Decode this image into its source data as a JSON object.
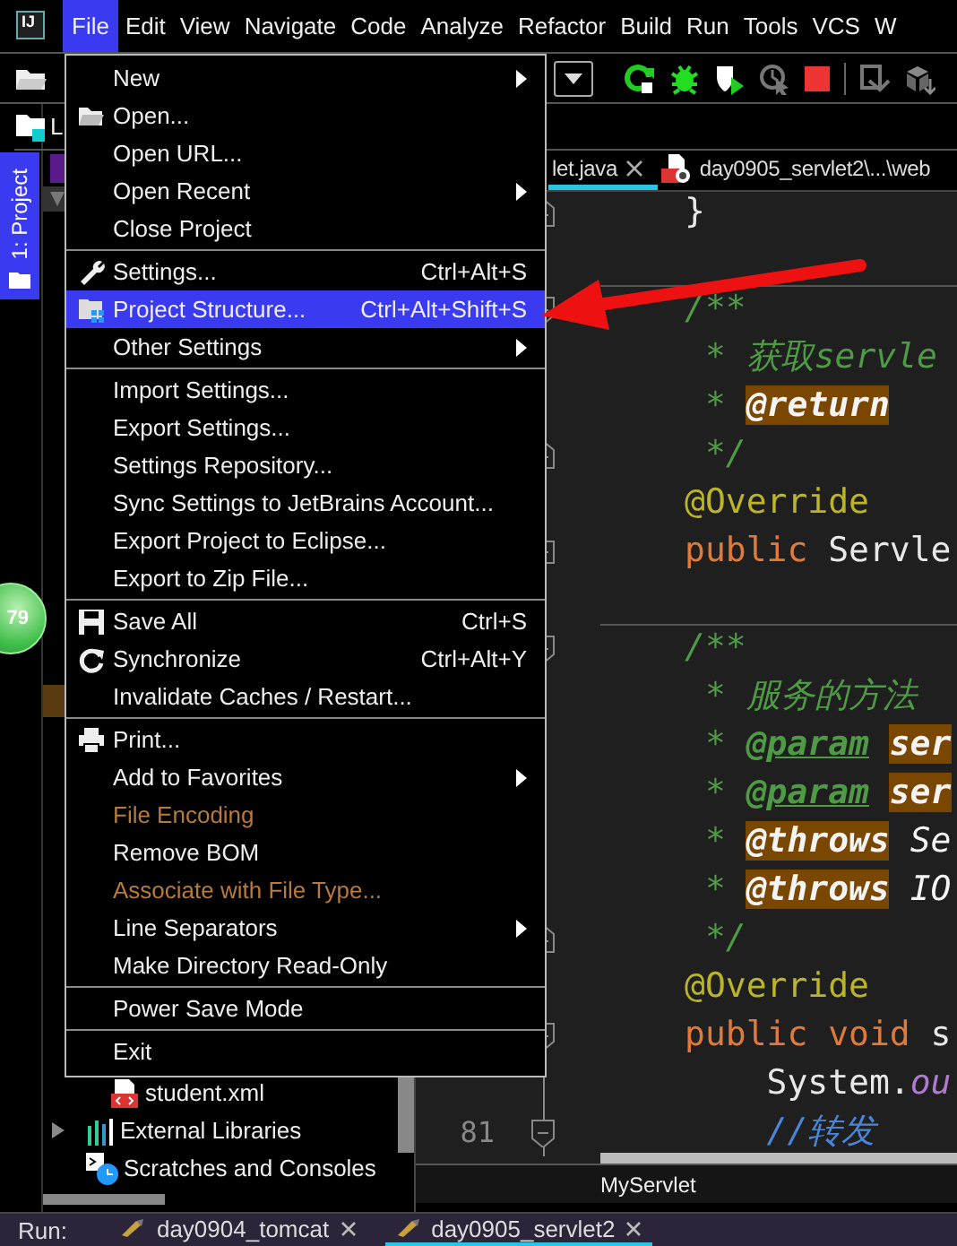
{
  "menubar": {
    "logo": "IJ",
    "items": [
      {
        "label": "File",
        "selected": true
      },
      {
        "label": "Edit",
        "selected": false
      },
      {
        "label": "View",
        "selected": false
      },
      {
        "label": "Navigate",
        "selected": false
      },
      {
        "label": "Code",
        "selected": false
      },
      {
        "label": "Analyze",
        "selected": false
      },
      {
        "label": "Refactor",
        "selected": false
      },
      {
        "label": "Build",
        "selected": false
      },
      {
        "label": "Run",
        "selected": false
      },
      {
        "label": "Tools",
        "selected": false
      },
      {
        "label": "VCS",
        "selected": false
      },
      {
        "label": "W",
        "selected": false
      }
    ]
  },
  "project_panel": {
    "title": "L",
    "tool_tab": {
      "label": "1: Project",
      "selected": true
    },
    "tree": [
      {
        "name": "student.xml",
        "kind": "xml-file"
      },
      {
        "name": "External Libraries",
        "kind": "libraries",
        "expanded": false
      },
      {
        "name": "Scratches and Consoles",
        "kind": "scratches"
      }
    ]
  },
  "badge": "79",
  "editor": {
    "tabs": [
      {
        "label": "let.java",
        "selected": true,
        "closable": true,
        "kind": "java"
      },
      {
        "label": "day0905_servlet2\\...\\web",
        "selected": false,
        "closable": false,
        "kind": "xml"
      }
    ],
    "blocks": [
      [
        {
          "kind": "fold-end",
          "tokens": [
            {
              "text": "}",
              "kind": "plain"
            }
          ]
        },
        {
          "kind": "blank"
        }
      ],
      [
        {
          "kind": "fold-start",
          "tokens": [
            {
              "text": "/**",
              "kind": "comment"
            }
          ]
        },
        {
          "kind": "plain",
          "tokens": [
            {
              "text": " * 获取servle",
              "kind": "comment"
            }
          ]
        },
        {
          "kind": "plain",
          "tokens": [
            {
              "text": " * ",
              "kind": "comment"
            },
            {
              "text": "@return",
              "kind": "tag-hl"
            }
          ]
        },
        {
          "kind": "fold-end",
          "tokens": [
            {
              "text": " */",
              "kind": "comment"
            }
          ]
        },
        {
          "kind": "plain",
          "tokens": [
            {
              "text": "@Override",
              "kind": "annotation"
            }
          ]
        },
        {
          "kind": "fold-collapsed",
          "tokens": [
            {
              "text": "public",
              "kind": "keyword"
            },
            {
              "text": " Servle",
              "kind": "plain"
            }
          ]
        },
        {
          "kind": "blank"
        }
      ],
      [
        {
          "kind": "fold-start",
          "tokens": [
            {
              "text": "/**",
              "kind": "comment"
            }
          ]
        },
        {
          "kind": "plain",
          "tokens": [
            {
              "text": " * 服务的方法",
              "kind": "comment"
            }
          ]
        },
        {
          "kind": "plain",
          "tokens": [
            {
              "text": " * ",
              "kind": "comment"
            },
            {
              "text": "@param",
              "kind": "doctag"
            },
            {
              "text": "ser",
              "kind": "value-hl"
            }
          ]
        },
        {
          "kind": "plain",
          "tokens": [
            {
              "text": " * ",
              "kind": "comment"
            },
            {
              "text": "@param",
              "kind": "doctag"
            },
            {
              "text": "ser",
              "kind": "value-hl"
            }
          ]
        },
        {
          "kind": "plain",
          "tokens": [
            {
              "text": " * ",
              "kind": "comment"
            },
            {
              "text": "@throws",
              "kind": "tag-hl"
            },
            {
              "text": " Se",
              "kind": "doctext"
            }
          ]
        },
        {
          "kind": "plain",
          "tokens": [
            {
              "text": " * ",
              "kind": "comment"
            },
            {
              "text": "@throws",
              "kind": "tag-hl"
            },
            {
              "text": " IO",
              "kind": "doctext"
            }
          ]
        },
        {
          "kind": "fold-end",
          "tokens": [
            {
              "text": " */",
              "kind": "comment"
            }
          ]
        },
        {
          "kind": "plain",
          "tokens": [
            {
              "text": "@Override",
              "kind": "annotation"
            }
          ]
        },
        {
          "kind": "fold-start",
          "tokens": [
            {
              "text": "public void",
              "kind": "keyword"
            },
            {
              "text": " s",
              "kind": "plain"
            }
          ]
        },
        {
          "kind": "plain",
          "tokens": [
            {
              "text": "    System.",
              "kind": "plain"
            },
            {
              "text": "ou",
              "kind": "field"
            }
          ]
        },
        {
          "kind": "fold-start",
          "number": "81",
          "tokens": [
            {
              "text": "    //转发",
              "kind": "line-comment"
            }
          ]
        }
      ]
    ],
    "breadcrumb": "MyServlet"
  },
  "file_menu": {
    "sections": [
      [
        {
          "label": "New",
          "kind": "plain",
          "submenu": true,
          "selected": false,
          "disabled": false
        },
        {
          "label": "Open...",
          "kind": "folder",
          "submenu": false,
          "selected": false,
          "disabled": false
        },
        {
          "label": "Open URL...",
          "kind": "plain",
          "submenu": false,
          "selected": false,
          "disabled": false
        },
        {
          "label": "Open Recent",
          "kind": "plain",
          "submenu": true,
          "selected": false,
          "disabled": false
        },
        {
          "label": "Close Project",
          "kind": "plain",
          "submenu": false,
          "selected": false,
          "disabled": false
        }
      ],
      [
        {
          "label": "Settings...",
          "kind": "wrench",
          "shortcut": "Ctrl+Alt+S",
          "submenu": false,
          "selected": false,
          "disabled": false
        },
        {
          "label": "Project Structure...",
          "kind": "structure",
          "shortcut": "Ctrl+Alt+Shift+S",
          "submenu": false,
          "selected": true,
          "disabled": false
        },
        {
          "label": "Other Settings",
          "kind": "plain",
          "submenu": true,
          "selected": false,
          "disabled": false
        }
      ],
      [
        {
          "label": "Import Settings...",
          "kind": "plain",
          "submenu": false,
          "selected": false,
          "disabled": false
        },
        {
          "label": "Export Settings...",
          "kind": "plain",
          "submenu": false,
          "selected": false,
          "disabled": false
        },
        {
          "label": "Settings Repository...",
          "kind": "plain",
          "submenu": false,
          "selected": false,
          "disabled": false
        },
        {
          "label": "Sync Settings to JetBrains Account...",
          "kind": "plain",
          "submenu": false,
          "selected": false,
          "disabled": false
        },
        {
          "label": "Export Project to Eclipse...",
          "kind": "plain",
          "submenu": false,
          "selected": false,
          "disabled": false
        },
        {
          "label": "Export to Zip File...",
          "kind": "plain",
          "submenu": false,
          "selected": false,
          "disabled": false
        }
      ],
      [
        {
          "label": "Save All",
          "kind": "save",
          "shortcut": "Ctrl+S",
          "submenu": false,
          "selected": false,
          "disabled": false
        },
        {
          "label": "Synchronize",
          "kind": "sync",
          "shortcut": "Ctrl+Alt+Y",
          "submenu": false,
          "selected": false,
          "disabled": false
        },
        {
          "label": "Invalidate Caches / Restart...",
          "kind": "plain",
          "submenu": false,
          "selected": false,
          "disabled": false
        }
      ],
      [
        {
          "label": "Print...",
          "kind": "print",
          "submenu": false,
          "selected": false,
          "disabled": false
        },
        {
          "label": "Add to Favorites",
          "kind": "plain",
          "submenu": true,
          "selected": false,
          "disabled": false
        },
        {
          "label": "File Encoding",
          "kind": "plain",
          "submenu": false,
          "selected": false,
          "disabled": true
        },
        {
          "label": "Remove BOM",
          "kind": "plain",
          "submenu": false,
          "selected": false,
          "disabled": false
        },
        {
          "label": "Associate with File Type...",
          "kind": "plain",
          "submenu": false,
          "selected": false,
          "disabled": true
        },
        {
          "label": "Line Separators",
          "kind": "plain",
          "submenu": true,
          "selected": false,
          "disabled": false
        },
        {
          "label": "Make Directory Read-Only",
          "kind": "plain",
          "submenu": false,
          "selected": false,
          "disabled": false
        }
      ],
      [
        {
          "label": "Power Save Mode",
          "kind": "plain",
          "submenu": false,
          "selected": false,
          "disabled": false
        }
      ],
      [
        {
          "label": "Exit",
          "kind": "plain",
          "submenu": false,
          "selected": false,
          "disabled": false
        }
      ]
    ]
  },
  "run_bar": {
    "label": "Run:",
    "tabs": [
      {
        "label": "day0904_tomcat",
        "selected": false
      },
      {
        "label": "day0905_servlet2",
        "selected": true
      }
    ]
  }
}
